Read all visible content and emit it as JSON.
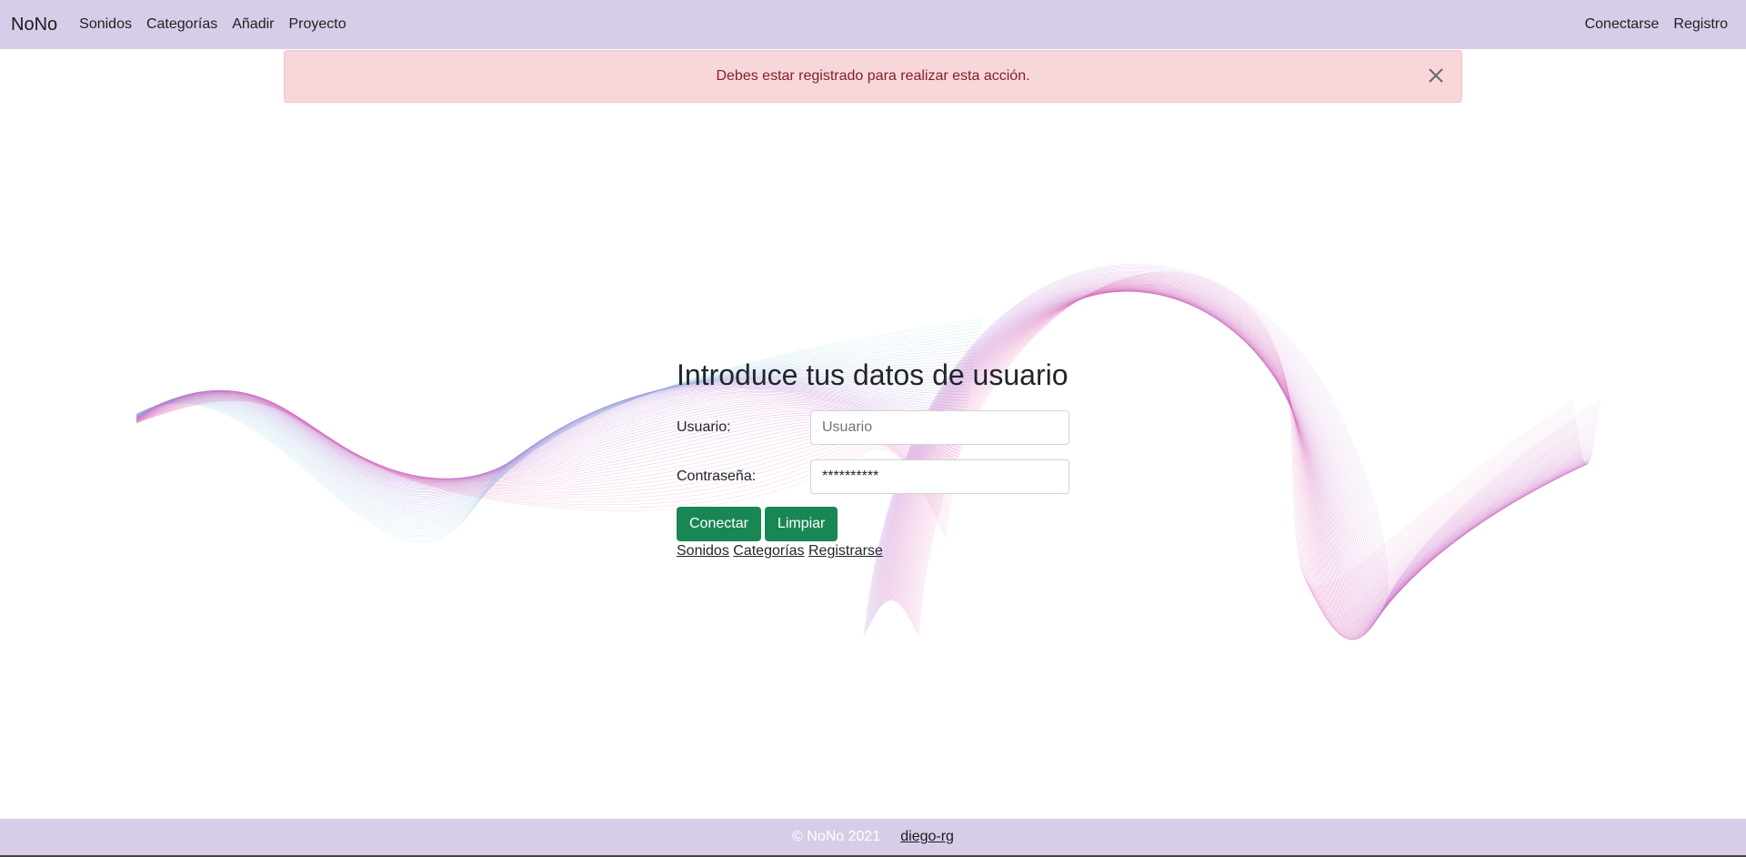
{
  "navbar": {
    "brand": "NoNo",
    "left_links": [
      "Sonidos",
      "Categorías",
      "Añadir",
      "Proyecto"
    ],
    "right_links": [
      "Conectarse",
      "Registro"
    ],
    "background": "#d8cde8"
  },
  "alert": {
    "message": "Debes estar registrado para realizar esta acción.",
    "close_icon": "close-icon",
    "background": "#f8d7da",
    "text_color": "#842029"
  },
  "login": {
    "title": "Introduce tus datos de usuario",
    "username_label": "Usuario:",
    "username_placeholder": "Usuario",
    "username_value": "",
    "password_label": "Contraseña:",
    "password_value": "**********",
    "connect_button": "Conectar",
    "clear_button": "Limpiar",
    "links": [
      "Sonidos",
      "Categorías",
      "Registrarse"
    ],
    "button_color": "#198754"
  },
  "footer": {
    "copyright": "© NoNo 2021",
    "author_link": "diego-rg",
    "background": "#d8cde8"
  }
}
